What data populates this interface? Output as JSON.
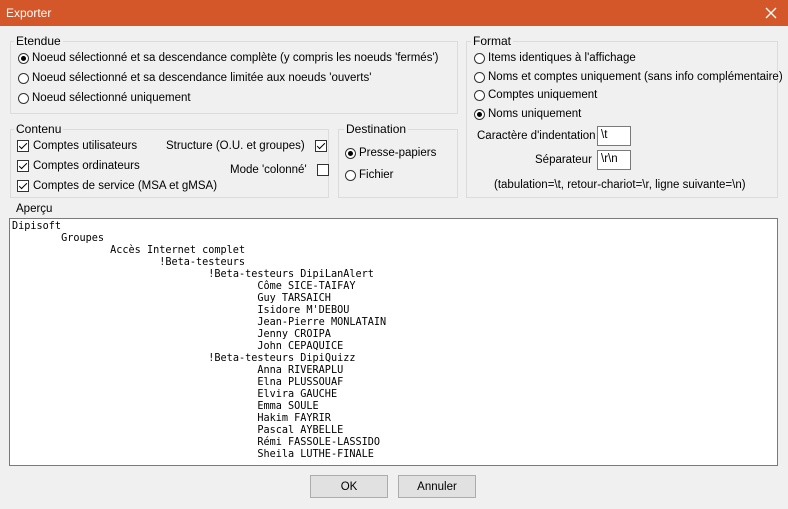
{
  "window": {
    "title": "Exporter",
    "close_glyph": "✕"
  },
  "etendue": {
    "legend": "Etendue",
    "options": [
      "Noeud sélectionné et sa descendance complète (y compris les noeuds 'fermés')",
      "Noeud sélectionné et sa descendance limitée aux noeuds 'ouverts'",
      "Noeud sélectionné uniquement"
    ],
    "selected_index": 0
  },
  "contenu": {
    "legend": "Contenu",
    "checks": [
      {
        "label": "Comptes utilisateurs",
        "checked": true
      },
      {
        "label": "Comptes ordinateurs",
        "checked": true
      },
      {
        "label": "Comptes de service (MSA et gMSA)",
        "checked": true
      },
      {
        "label": "Structure (O.U. et groupes)",
        "checked": true
      },
      {
        "label": "Mode 'colonné'",
        "checked": false
      }
    ]
  },
  "destination": {
    "legend": "Destination",
    "options": [
      "Presse-papiers",
      "Fichier"
    ],
    "selected_index": 0
  },
  "format": {
    "legend": "Format",
    "options": [
      "Items identiques à l'affichage",
      "Noms et comptes uniquement (sans info complémentaire)",
      "Comptes uniquement",
      "Noms uniquement"
    ],
    "selected_index": 3,
    "indent_label": "Caractère d'indentation",
    "indent_value": "\\t",
    "sep_label": "Séparateur",
    "sep_value": "\\r\\n",
    "hint": "(tabulation=\\t, retour-chariot=\\r, ligne suivante=\\n)"
  },
  "apercu": {
    "legend": "Aperçu",
    "lines": [
      "Dipisoft",
      "\tGroupes",
      "\t\tAccès Internet complet",
      "\t\t\t!Beta-testeurs",
      "\t\t\t\t!Beta-testeurs DipiLanAlert",
      "\t\t\t\t\tCôme SICE-TAIFAY",
      "\t\t\t\t\tGuy TARSAICH",
      "\t\t\t\t\tIsidore M'DEBOU",
      "\t\t\t\t\tJean-Pierre MONLATAIN",
      "\t\t\t\t\tJenny CROIPA",
      "\t\t\t\t\tJohn CEPAQUICE",
      "\t\t\t\t!Beta-testeurs DipiQuizz",
      "\t\t\t\t\tAnna RIVERAPLU",
      "\t\t\t\t\tElna PLUSSOUAF",
      "\t\t\t\t\tElvira GAUCHE",
      "\t\t\t\t\tEmma SOULE",
      "\t\t\t\t\tHakim FAYRIR",
      "\t\t\t\t\tPascal AYBELLE",
      "\t\t\t\t\tRémi FASSOLE-LASSIDO",
      "\t\t\t\t\tSheila LUTHE-FINALE"
    ]
  },
  "buttons": {
    "ok": "OK",
    "cancel": "Annuler"
  }
}
